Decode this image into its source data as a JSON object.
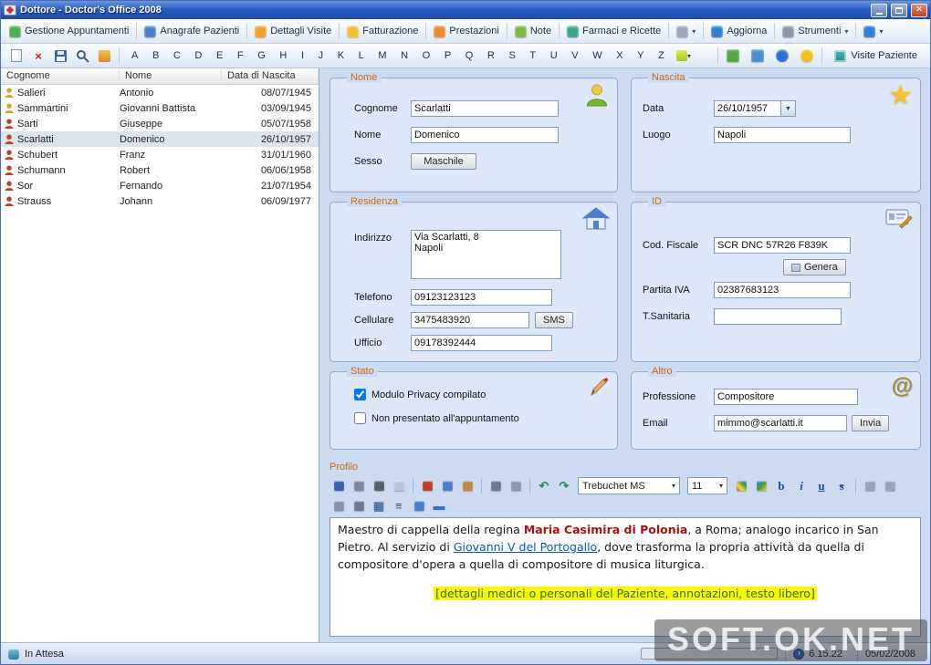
{
  "window": {
    "title": "Dottore - Doctor's Office 2008"
  },
  "icons": {
    "close": "×",
    "caret_down": "▾",
    "dropdown": "▼",
    "star": "★",
    "at": "@"
  },
  "menubar": {
    "items": [
      {
        "id": "gestione-appuntamenti",
        "label": "Gestione Appuntamenti",
        "icon": "appointments-icon",
        "color": "#4caf50"
      },
      {
        "id": "anagrafe-pazienti",
        "label": "Anagrafe Pazienti",
        "icon": "patients-icon",
        "color": "#4a7fd0"
      },
      {
        "id": "dettagli-visite",
        "label": "Dettagli Visite",
        "icon": "visits-icon",
        "color": "#f0a228"
      },
      {
        "id": "fatturazione",
        "label": "Fatturazione",
        "icon": "billing-icon",
        "color": "#f6c02e"
      },
      {
        "id": "prestazioni",
        "label": "Prestazioni",
        "icon": "services-icon",
        "color": "#ef8a2c"
      },
      {
        "id": "note",
        "label": "Note",
        "icon": "notes-icon",
        "color": "#7cb93e"
      },
      {
        "id": "farmaci-e-ricette",
        "label": "Farmaci e Ricette",
        "icon": "pharmacy-icon",
        "color": "#3aa68c"
      },
      {
        "id": "extra",
        "label": "",
        "icon": "extra-menu-icon",
        "color": "#9aa8ba",
        "caret": true
      },
      {
        "id": "aggiorna",
        "label": "Aggiorna",
        "icon": "refresh-icon",
        "color": "#2f7fd6"
      },
      {
        "id": "strumenti",
        "label": "Strumenti",
        "icon": "tools-icon",
        "color": "#8a98aa",
        "caret": true
      },
      {
        "id": "help",
        "label": "",
        "icon": "help-icon",
        "color": "#2f7fd6",
        "caret": true
      }
    ]
  },
  "toolbar": {
    "letters": [
      "A",
      "B",
      "C",
      "D",
      "E",
      "F",
      "G",
      "H",
      "I",
      "J",
      "K",
      "L",
      "M",
      "N",
      "O",
      "P",
      "Q",
      "R",
      "S",
      "T",
      "U",
      "V",
      "W",
      "X",
      "Y",
      "Z"
    ],
    "right_icons": [
      {
        "name": "reports-icon",
        "color": "#54a646"
      },
      {
        "name": "print-list-icon",
        "color": "#4a8fd4"
      },
      {
        "name": "sync-icon",
        "color": "#2f6fd0",
        "round": true
      },
      {
        "name": "alerts-icon",
        "color": "#f2c014",
        "round": true
      }
    ],
    "visite_label": "Visite Paziente"
  },
  "patients": {
    "columns": [
      "Cognome",
      "Nome",
      "Data di Nascita"
    ],
    "rows": [
      {
        "cognome": "Salieri",
        "nome": "Antonio",
        "nascita": "08/07/1945",
        "icon_color": "#d9a520",
        "selected": false
      },
      {
        "cognome": "Sammartini",
        "nome": "Giovanni Battista",
        "nascita": "03/09/1945",
        "icon_color": "#d9a520",
        "selected": false
      },
      {
        "cognome": "Sarti",
        "nome": "Giuseppe",
        "nascita": "05/07/1958",
        "icon_color": "#c23b22",
        "selected": false
      },
      {
        "cognome": "Scarlatti",
        "nome": "Domenico",
        "nascita": "26/10/1957",
        "icon_color": "#c23b22",
        "selected": true
      },
      {
        "cognome": "Schubert",
        "nome": "Franz",
        "nascita": "31/01/1960",
        "icon_color": "#c23b22",
        "selected": false
      },
      {
        "cognome": "Schumann",
        "nome": "Robert",
        "nascita": "06/06/1958",
        "icon_color": "#c23b22",
        "selected": false
      },
      {
        "cognome": "Sor",
        "nome": "Fernando",
        "nascita": "21/07/1954",
        "icon_color": "#c23b22",
        "selected": false
      },
      {
        "cognome": "Strauss",
        "nome": "Johann",
        "nascita": "06/09/1977",
        "icon_color": "#c23b22",
        "selected": false
      }
    ]
  },
  "form": {
    "nome": {
      "title": "Nome",
      "cognome_label": "Cognome",
      "cognome_value": "Scarlatti",
      "nome_label": "Nome",
      "nome_value": "Domenico",
      "sesso_label": "Sesso",
      "sesso_value": "Maschile"
    },
    "nascita": {
      "title": "Nascita",
      "data_label": "Data",
      "data_value": "26/10/1957",
      "luogo_label": "Luogo",
      "luogo_value": "Napoli"
    },
    "residenza": {
      "title": "Residenza",
      "indirizzo_label": "Indirizzo",
      "indirizzo_value": "Via Scarlatti, 8\nNapoli",
      "telefono_label": "Telefono",
      "telefono_value": "09123123123",
      "cellulare_label": "Cellulare",
      "cellulare_value": "3475483920",
      "sms_label": "SMS",
      "ufficio_label": "Ufficio",
      "ufficio_value": "09178392444"
    },
    "id": {
      "title": "ID",
      "cf_label": "Cod. Fiscale",
      "cf_value": "SCR DNC 57R26 F839K",
      "genera_label": "Genera",
      "piva_label": "Partita IVA",
      "piva_value": "02387683123",
      "ts_label": "T.Sanitaria",
      "ts_value": ""
    },
    "stato": {
      "title": "Stato",
      "privacy_label": "Modulo Privacy compilato",
      "privacy_checked": true,
      "noshow_label": "Non presentato all'appuntamento",
      "noshow_checked": false
    },
    "altro": {
      "title": "Altro",
      "professione_label": "Professione",
      "professione_value": "Compositore",
      "email_label": "Email",
      "email_value": "mimmo@scarlatti.it",
      "invia_label": "Invia"
    }
  },
  "profilo": {
    "title": "Profilo",
    "font_label": "Trebuchet MS",
    "size_label": "11",
    "toolbar1a": [
      {
        "name": "save-icon",
        "color": "#3a62b0"
      },
      {
        "name": "preview-icon",
        "color": "#7a8aa0"
      },
      {
        "name": "print-icon",
        "color": "#55606e"
      },
      {
        "name": "page-setup-icon",
        "color": "#b9c6da"
      },
      {
        "sep": true
      },
      {
        "name": "cut-icon",
        "color": "#c23b22"
      },
      {
        "name": "copy-icon",
        "color": "#4a7fd0"
      },
      {
        "name": "paste-icon",
        "color": "#c08a3e"
      },
      {
        "sep": true
      },
      {
        "name": "find-icon",
        "color": "#6a7a94"
      },
      {
        "name": "hyperlink-icon",
        "color": "#8a9ab0"
      },
      {
        "sep": true
      },
      {
        "name": "undo-icon",
        "glyph": "↶",
        "color": "#2e8b57"
      },
      {
        "name": "redo-icon",
        "glyph": "↷",
        "color": "#2e8b57"
      }
    ],
    "toolbar1b": [
      {
        "name": "font-color-icon",
        "gradient": "linear-gradient(45deg,#e53935,#fdd835,#43a047,#1e88e5)"
      },
      {
        "name": "highlight-color-icon",
        "gradient": "linear-gradient(135deg,#1e88e5,#43a047,#fdd835)"
      },
      {
        "name": "bold-icon",
        "glyph": "b",
        "color": "#1a4fa0"
      },
      {
        "name": "italic-icon",
        "glyph": "i",
        "color": "#1a4fa0",
        "italic": true
      },
      {
        "name": "underline-icon",
        "glyph": "u",
        "color": "#1a4fa0",
        "underline": true
      },
      {
        "name": "strikethrough-icon",
        "glyph": "s",
        "color": "#1a4fa0",
        "strike": true
      },
      {
        "sep": true
      },
      {
        "name": "subscript-icon",
        "color": "#98a5b8"
      },
      {
        "name": "superscript-icon",
        "color": "#98a5b8"
      }
    ],
    "toolbar2": [
      {
        "name": "page-break-icon",
        "color": "#8a93a5"
      },
      {
        "name": "columns-icon",
        "color": "#6a7a94"
      },
      {
        "name": "insert-table-icon",
        "glyph": "▦",
        "color": "#4a6fa5"
      },
      {
        "name": "bullet-list-icon",
        "glyph": "≡",
        "color": "#3a4a60"
      },
      {
        "name": "insert-grid-icon",
        "color": "#4a7fd0"
      },
      {
        "name": "horizontal-rule-icon",
        "glyph": "▬",
        "color": "#2f6fd0"
      }
    ],
    "text": {
      "p1_before": "Maestro di cappella della regina ",
      "p1_bold": "Maria Casimira di Polonia",
      "p1_mid": ", a Roma; analogo incarico in San Pietro. Al servizio di ",
      "p1_link": "Giovanni V del Portogallo",
      "p1_after": ", dove trasforma la propria attività da quella di compositore d'opera a quella di compositore di musica liturgica.",
      "highlight": "[dettagli medici o personali del Paziente, annotazioni, testo libero]"
    }
  },
  "statusbar": {
    "status": "In Attesa",
    "time": "6.15.22",
    "date": "05/02/2008"
  },
  "watermark": {
    "text": "SOFT.OK.NET"
  }
}
